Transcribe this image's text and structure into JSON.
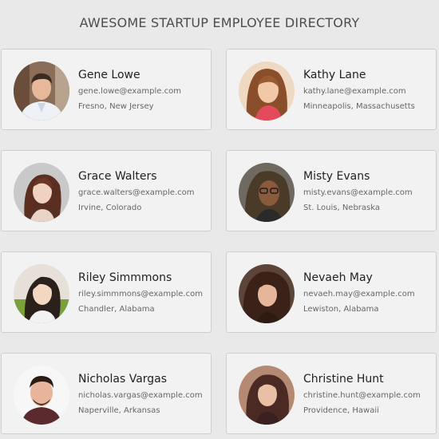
{
  "page": {
    "title": "AWESOME STARTUP EMPLOYEE DIRECTORY"
  },
  "employees": [
    {
      "name": "Gene Lowe",
      "email": "gene.lowe@example.com",
      "location": "Fresno, New Jersey",
      "avatar_icon": "person-photo-icon"
    },
    {
      "name": "Kathy Lane",
      "email": "kathy.lane@example.com",
      "location": "Minneapolis, Massachusetts",
      "avatar_icon": "person-photo-icon"
    },
    {
      "name": "Grace Walters",
      "email": "grace.walters@example.com",
      "location": "Irvine, Colorado",
      "avatar_icon": "person-photo-icon"
    },
    {
      "name": "Misty Evans",
      "email": "misty.evans@example.com",
      "location": "St. Louis, Nebraska",
      "avatar_icon": "person-photo-icon"
    },
    {
      "name": "Riley Simmmons",
      "email": "riley.simmmons@example.com",
      "location": "Chandler, Alabama",
      "avatar_icon": "person-photo-icon"
    },
    {
      "name": "Nevaeh May",
      "email": "nevaeh.may@example.com",
      "location": "Lewiston, Alabama",
      "avatar_icon": "person-photo-icon"
    },
    {
      "name": "Nicholas Vargas",
      "email": "nicholas.vargas@example.com",
      "location": "Naperville, Arkansas",
      "avatar_icon": "person-photo-icon"
    },
    {
      "name": "Christine Hunt",
      "email": "christine.hunt@example.com",
      "location": "Providence, Hawaii",
      "avatar_icon": "person-photo-icon"
    }
  ],
  "colors": {
    "background": "#e9e9e9",
    "card": "#f2f2f2",
    "card_border": "#cfcfcf",
    "name_text": "#222222",
    "detail_text": "#666666"
  }
}
